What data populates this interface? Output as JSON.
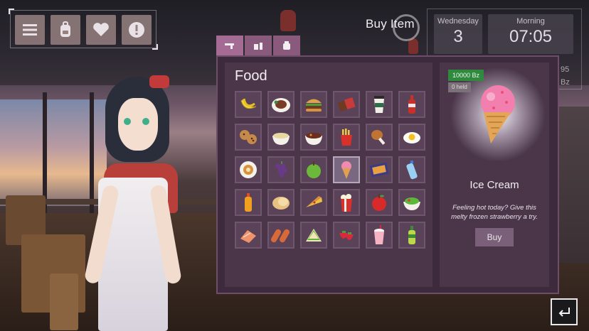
{
  "hud": {
    "buttons": [
      {
        "name": "menu-icon"
      },
      {
        "name": "backpack-icon"
      },
      {
        "name": "heart-icon"
      },
      {
        "name": "alert-icon"
      }
    ],
    "day_label": "Wednesday",
    "day_value": "3",
    "period_label": "Morning",
    "time_value": "07:05",
    "side_numbers": [
      "95",
      "Bz"
    ]
  },
  "shop": {
    "title": "Buy Item",
    "tabs": [
      {
        "icon": "gun-icon",
        "active": true
      },
      {
        "icon": "drink-icon",
        "active": false
      },
      {
        "icon": "jar-icon",
        "active": false
      }
    ],
    "category": "Food",
    "items": [
      "banana",
      "steak",
      "burger",
      "chocolate",
      "coffee-cup",
      "soda-bottle",
      "cookies",
      "soup",
      "stew-bowl",
      "fries",
      "chicken-leg",
      "fried-egg",
      "waffle-plate",
      "grapes",
      "apple",
      "ice-cream",
      "lasagna-tray",
      "water-bottle",
      "orange-juice",
      "bread",
      "pizza-slice",
      "popcorn",
      "red-apple",
      "salad",
      "salmon",
      "sausages",
      "sandwich",
      "strawberries",
      "milkshake",
      "green-bottle"
    ],
    "selected_index": 15,
    "detail": {
      "price": "10000 Bz",
      "held": "0 held",
      "name": "Ice Cream",
      "description": "Feeling hot today? Give this melty frozen strawberry a try.",
      "buy_label": "Buy"
    }
  },
  "colors": {
    "panel": "#3d2b3d",
    "tab": "#8a5a7c",
    "price_tag": "#2f8a3e"
  }
}
